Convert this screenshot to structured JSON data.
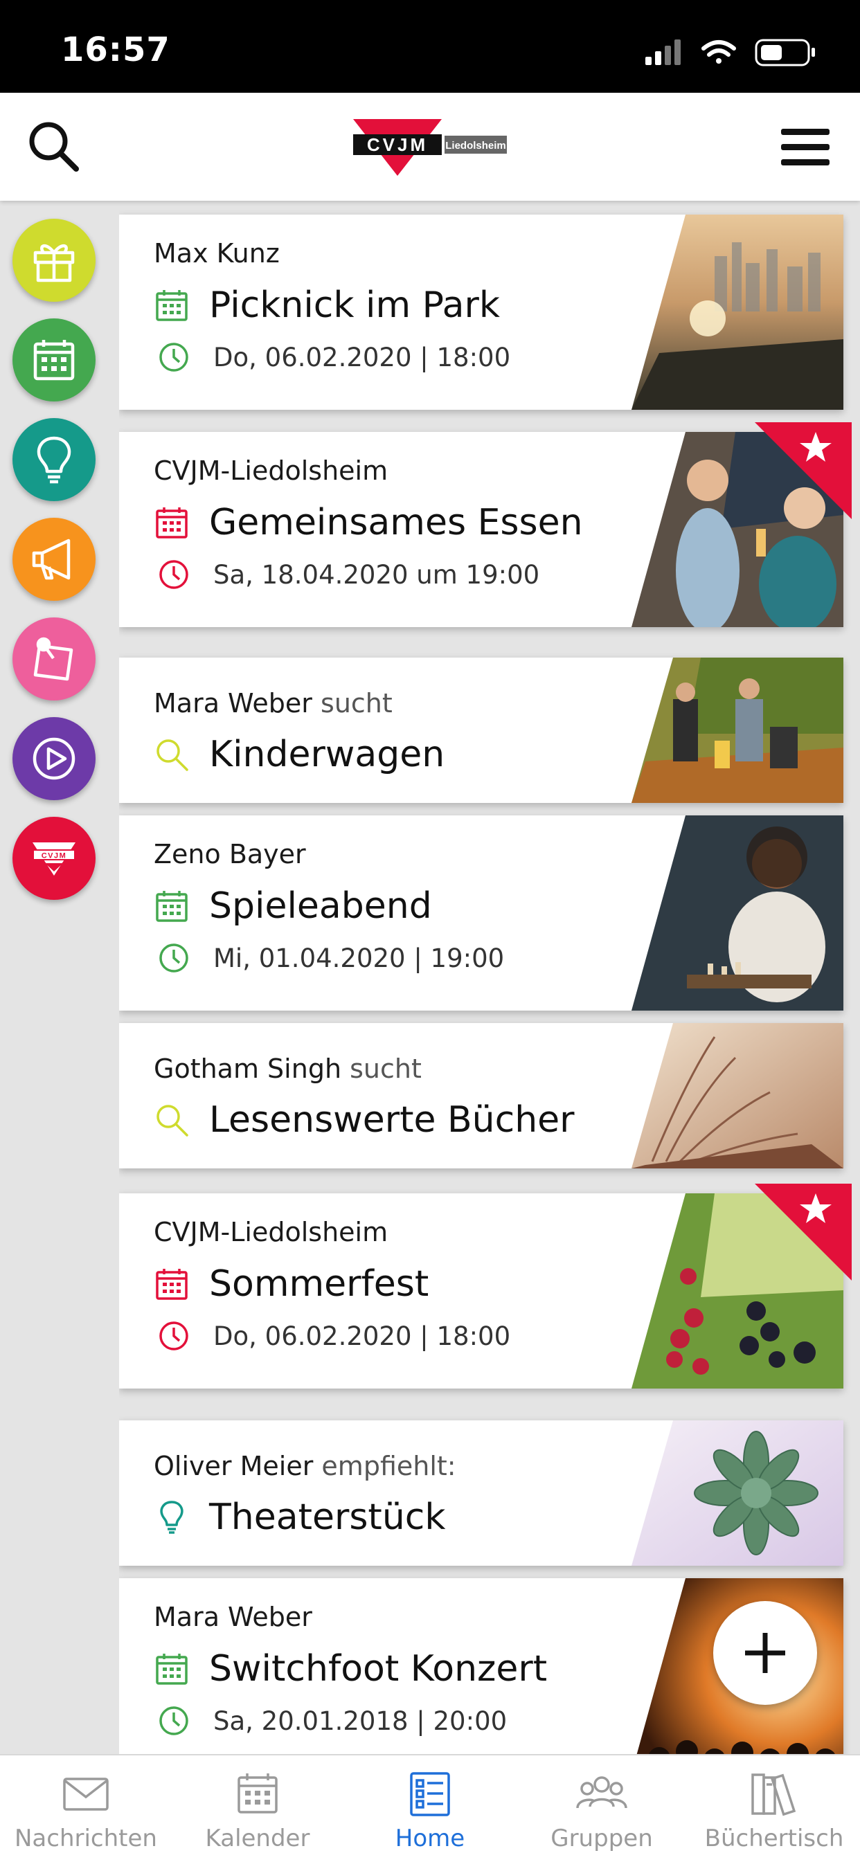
{
  "status": {
    "time": "16:57"
  },
  "header": {
    "logo_text": "CVJM",
    "logo_sub": "Liedolsheim"
  },
  "categories": [
    {
      "name": "gift",
      "color": "#cfdb2e"
    },
    {
      "name": "calendar",
      "color": "#44a84f"
    },
    {
      "name": "lightbulb",
      "color": "#159a8a"
    },
    {
      "name": "megaphone",
      "color": "#f7931d"
    },
    {
      "name": "pinned-note",
      "color": "#ee5f9c"
    },
    {
      "name": "play",
      "color": "#6d3aa8"
    },
    {
      "name": "cvjm",
      "color": "#e3103a"
    }
  ],
  "cards": [
    {
      "author": "Max Kunz",
      "suffix": "",
      "title": "Picknick im Park",
      "date": "Do, 06.02.2020 | 18:00",
      "type": "event",
      "accent": "#44a84f",
      "starred": false
    },
    {
      "author": "CVJM-Liedolsheim",
      "suffix": "",
      "title": "Gemeinsames Essen",
      "date": "Sa, 18.04.2020 um 19:00",
      "type": "event",
      "accent": "#e3103a",
      "starred": true
    },
    {
      "author": "Mara Weber",
      "suffix": "sucht",
      "title": "Kinderwagen",
      "date": "",
      "type": "search",
      "accent": "#cfdb2e",
      "starred": false
    },
    {
      "author": "Zeno Bayer",
      "suffix": "",
      "title": "Spieleabend",
      "date": "Mi, 01.04.2020 | 19:00",
      "type": "event",
      "accent": "#44a84f",
      "starred": false
    },
    {
      "author": "Gotham Singh",
      "suffix": "sucht",
      "title": "Lesenswerte Bücher",
      "date": "",
      "type": "search",
      "accent": "#cfdb2e",
      "starred": false
    },
    {
      "author": "CVJM-Liedolsheim",
      "suffix": "",
      "title": "Sommerfest",
      "date": "Do, 06.02.2020 | 18:00",
      "type": "event",
      "accent": "#e3103a",
      "starred": true
    },
    {
      "author": "Oliver Meier",
      "suffix": "empfiehlt:",
      "title": "Theaterstück",
      "date": "",
      "type": "tip",
      "accent": "#159a8a",
      "starred": false
    },
    {
      "author": "Mara Weber",
      "suffix": "",
      "title": "Switchfoot Konzert",
      "date": "Sa, 20.01.2018 | 20:00",
      "type": "event",
      "accent": "#44a84f",
      "starred": false
    }
  ],
  "tabs": [
    {
      "label": "Nachrichten",
      "icon": "envelope-icon",
      "active": false
    },
    {
      "label": "Kalender",
      "icon": "calendar-icon",
      "active": false
    },
    {
      "label": "Home",
      "icon": "home-list-icon",
      "active": true
    },
    {
      "label": "Gruppen",
      "icon": "group-icon",
      "active": false
    },
    {
      "label": "Büchertisch",
      "icon": "books-icon",
      "active": false
    }
  ],
  "colors": {
    "accent_blue": "#1e6fd9",
    "brand_red": "#e3103a"
  }
}
